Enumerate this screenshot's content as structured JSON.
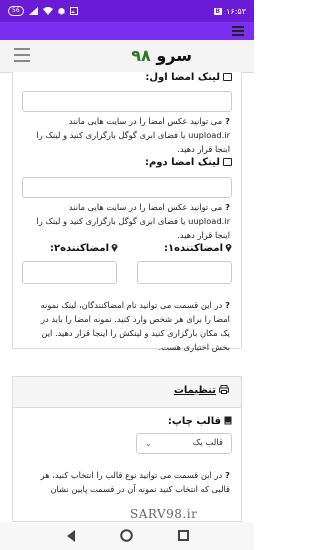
{
  "statusbar": {
    "time": "۱۶:۵۳",
    "badge": "B",
    "battery": "56"
  },
  "brand": {
    "text": "سرو",
    "number": "۹۸"
  },
  "signature1": {
    "label": "لینک امضا اول:",
    "help": "می توانید عکس امضا را در سایت هایی مانند uupload.ir یا فضای ابری گوگل بارگزاری کنید و لینک را اینجا قرار دهید."
  },
  "signature2": {
    "label": "لینک امضا دوم:",
    "help": "می توانید عکس امضا را در سایت هایی مانند uupload.ir یا فضای ابری گوگل بارگزاری کنید و لینک را اینجا قرار دهید."
  },
  "signer1": {
    "label": "امضاکننده۱:"
  },
  "signer2": {
    "label": "امضاکننده۲:"
  },
  "signers_help": "در این قسمت می توانید نام امضاکنندگان، لینک نمونه امضا را برای هر شخص وارد کنید. نمونه امضا را باید در یک مکان بارگزاری کنید و لینکش را اینجا قرار دهید. این بخش اختیاری هست.",
  "settings": {
    "title": "تنظیمات",
    "print_template_label": "قالب چاپ:",
    "print_template_value": "قالب یک",
    "help": "در این قسمت می توانید نوع قالب را انتخاب کنید، هر قالبی که انتخاب کنید نمونه آن در قسمت پایین نشان"
  },
  "watermark": "SARV98.ir"
}
